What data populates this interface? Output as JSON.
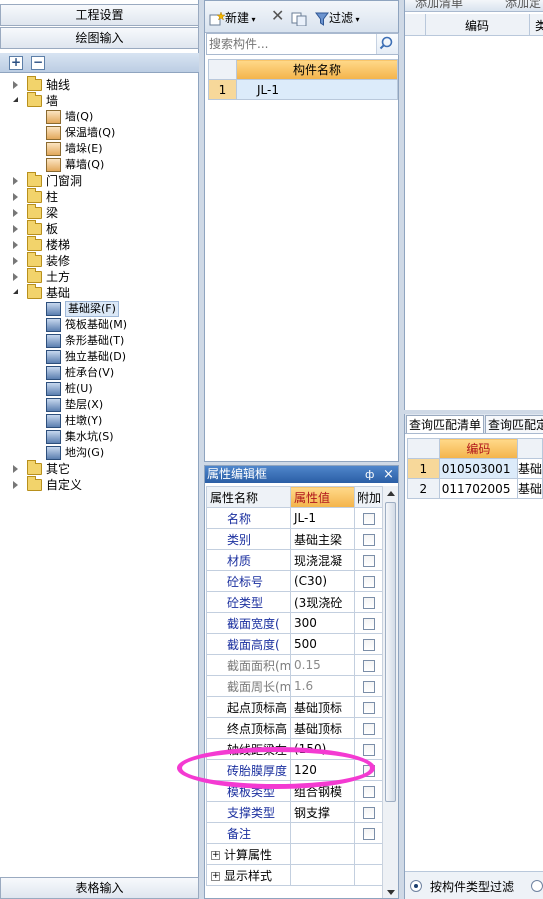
{
  "nav": {
    "project_settings": "工程设置",
    "drawing_input": "绘图输入",
    "table_input": "表格输入"
  },
  "tree": {
    "items": [
      {
        "label": "轴线",
        "type": "folder",
        "state": "collapsed"
      },
      {
        "label": "墙",
        "type": "folder",
        "state": "expanded"
      },
      {
        "label": "墙(Q)",
        "type": "leaf",
        "icon": "wall-icon"
      },
      {
        "label": "保温墙(Q)",
        "type": "leaf",
        "icon": "insulated-wall-icon"
      },
      {
        "label": "墙垛(E)",
        "type": "leaf",
        "icon": "wall-pier-icon"
      },
      {
        "label": "幕墙(Q)",
        "type": "leaf",
        "icon": "curtain-wall-icon"
      },
      {
        "label": "门窗洞",
        "type": "folder",
        "state": "collapsed"
      },
      {
        "label": "柱",
        "type": "folder",
        "state": "collapsed"
      },
      {
        "label": "梁",
        "type": "folder",
        "state": "collapsed"
      },
      {
        "label": "板",
        "type": "folder",
        "state": "collapsed"
      },
      {
        "label": "楼梯",
        "type": "folder",
        "state": "collapsed"
      },
      {
        "label": "装修",
        "type": "folder",
        "state": "collapsed"
      },
      {
        "label": "土方",
        "type": "folder",
        "state": "collapsed"
      },
      {
        "label": "基础",
        "type": "folder",
        "state": "expanded"
      },
      {
        "label": "基础梁(F)",
        "type": "leaf",
        "icon": "foundation-beam-icon",
        "selected": true
      },
      {
        "label": "筏板基础(M)",
        "type": "leaf",
        "icon": "raft-foundation-icon"
      },
      {
        "label": "条形基础(T)",
        "type": "leaf",
        "icon": "strip-foundation-icon"
      },
      {
        "label": "独立基础(D)",
        "type": "leaf",
        "icon": "isolated-footing-icon"
      },
      {
        "label": "桩承台(V)",
        "type": "leaf",
        "icon": "pile-cap-icon"
      },
      {
        "label": "桩(U)",
        "type": "leaf",
        "icon": "pile-icon"
      },
      {
        "label": "垫层(X)",
        "type": "leaf",
        "icon": "cushion-icon"
      },
      {
        "label": "柱墩(Y)",
        "type": "leaf",
        "icon": "column-pier-icon"
      },
      {
        "label": "集水坑(S)",
        "type": "leaf",
        "icon": "sump-pit-icon"
      },
      {
        "label": "地沟(G)",
        "type": "leaf",
        "icon": "trench-icon"
      },
      {
        "label": "其它",
        "type": "folder",
        "state": "collapsed"
      },
      {
        "label": "自定义",
        "type": "folder",
        "state": "collapsed"
      }
    ]
  },
  "component_list": {
    "new_label": "新建",
    "filter_label": "过滤",
    "search_placeholder": "搜索构件...",
    "column_header": "构件名称",
    "rows": [
      {
        "num": "1",
        "name": "JL-1"
      }
    ]
  },
  "properties": {
    "title": "属性编辑框",
    "pin": "ф",
    "close": "×",
    "headers": {
      "name": "属性名称",
      "value": "属性值",
      "attach": "附加"
    },
    "rows": [
      {
        "name": "名称",
        "value": "JL-1",
        "style": "blue"
      },
      {
        "name": "类别",
        "value": "基础主梁",
        "style": "blue"
      },
      {
        "name": "材质",
        "value": "现浇混凝",
        "style": "blue"
      },
      {
        "name": "砼标号",
        "value": "(C30)",
        "style": "blue"
      },
      {
        "name": "砼类型",
        "value": "(3现浇砼",
        "style": "blue"
      },
      {
        "name": "截面宽度(",
        "value": "300",
        "style": "blue"
      },
      {
        "name": "截面高度(",
        "value": "500",
        "style": "blue"
      },
      {
        "name": "截面面积(m",
        "value": "0.15",
        "style": "gray"
      },
      {
        "name": "截面周长(m",
        "value": "1.6",
        "style": "gray"
      },
      {
        "name": "起点顶标高",
        "value": "基础顶标",
        "style": "black"
      },
      {
        "name": "终点顶标高",
        "value": "基础顶标",
        "style": "black"
      },
      {
        "name": "轴线距梁左",
        "value": "(150)",
        "style": "black"
      },
      {
        "name": "砖胎膜厚度",
        "value": "120",
        "style": "blue"
      },
      {
        "name": "模板类型",
        "value": "组合钢模",
        "style": "blue"
      },
      {
        "name": "支撑类型",
        "value": "钢支撑",
        "style": "blue"
      },
      {
        "name": "备注",
        "value": "",
        "style": "blue"
      }
    ],
    "groups": [
      "计算属性",
      "显示样式"
    ]
  },
  "bill": {
    "add_list": "添加清单",
    "add_quota": "添加定",
    "code_header": "编码",
    "cut_header": "类",
    "tabs": [
      "查询匹配清单",
      "查询匹配定"
    ],
    "match_header": "编码",
    "match_rows": [
      {
        "num": "1",
        "code": "010503001",
        "cut": "基础"
      },
      {
        "num": "2",
        "code": "011702005",
        "cut": "基础"
      }
    ],
    "filter_by_type": "按构件类型过滤"
  },
  "colors": {
    "highlight_annotation": "#f43ad2",
    "header_orange": "#f3b34a",
    "selection_blue": "#dcebfa",
    "property_blue_text": "#1a2f9f"
  }
}
